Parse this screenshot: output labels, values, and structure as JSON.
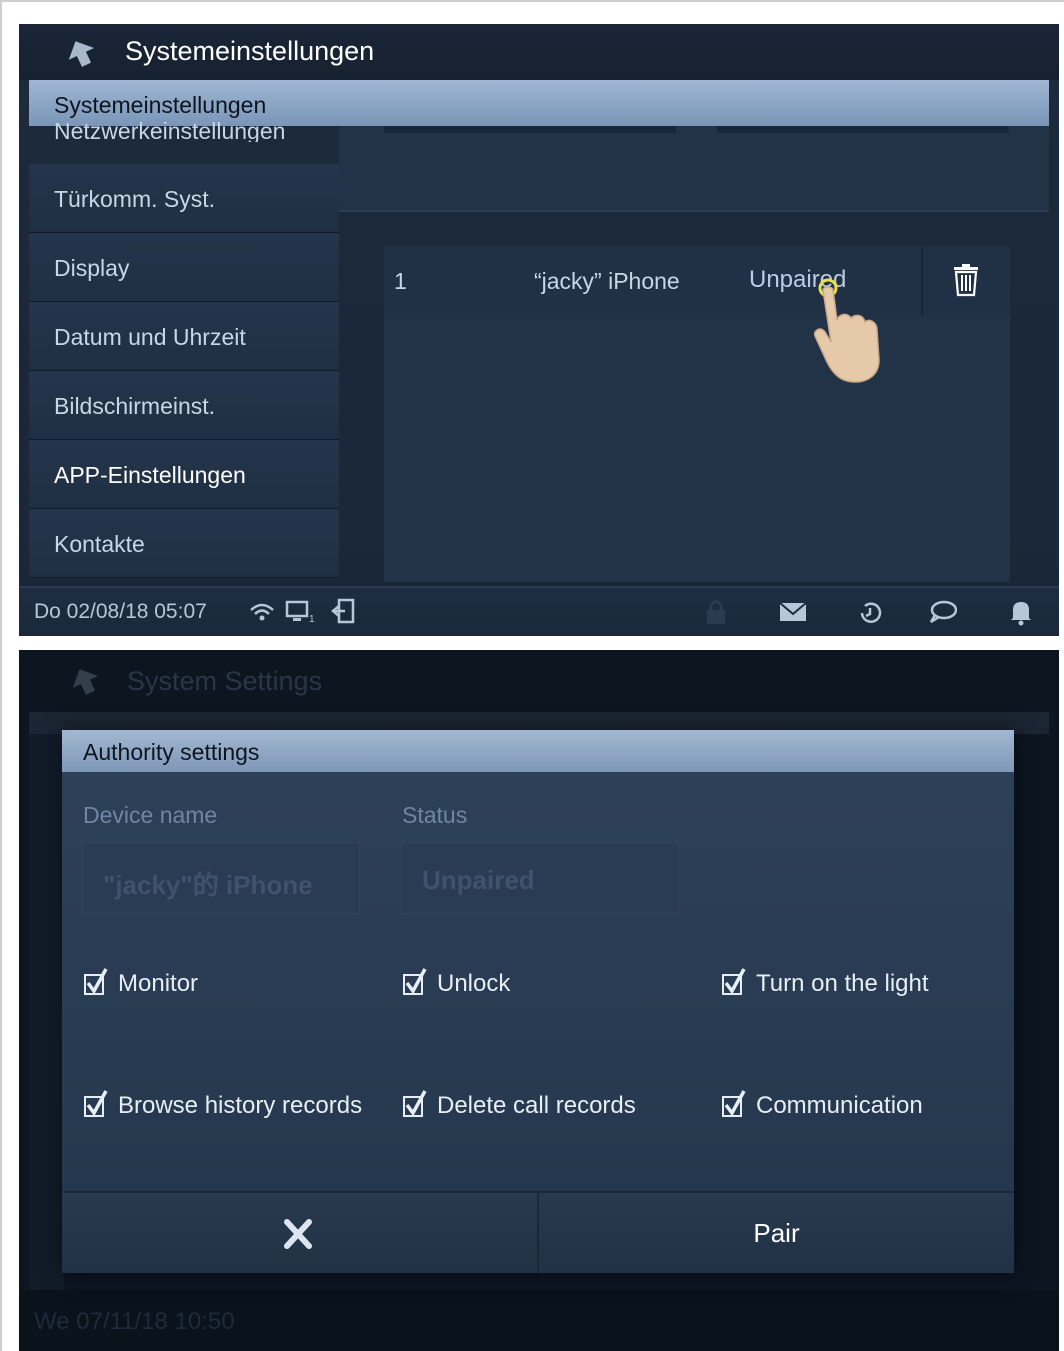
{
  "screen1": {
    "title": "Systemeinstellungen",
    "highlight_label": "Systemeinstellungen",
    "partial_item": "Netzwerkeinstellungen",
    "menu": [
      {
        "label": "Türkomm. Syst."
      },
      {
        "label": "Display"
      },
      {
        "label": "Datum und Uhrzeit"
      },
      {
        "label": "Bildschirmeinst."
      },
      {
        "label": "APP-Einstellungen"
      },
      {
        "label": "Kontakte"
      }
    ],
    "device_row": {
      "number": "1",
      "device_name": "“jacky” iPhone",
      "status": "Unpaired"
    },
    "status_bar": {
      "datetime": "Do 02/08/18  05:07"
    }
  },
  "screen2": {
    "background_title": "System Settings",
    "background_time": "We 07/11/18  10:50",
    "dialog": {
      "title": "Authority settings",
      "device_name_label": "Device name",
      "device_name_value": "\"jacky\"的 iPhone",
      "status_label": "Status",
      "status_value": "Unpaired",
      "permissions": [
        {
          "label": "Monitor",
          "checked": true
        },
        {
          "label": "Unlock",
          "checked": true
        },
        {
          "label": "Turn on the light",
          "checked": true
        },
        {
          "label": "Browse history records",
          "checked": true
        },
        {
          "label": "Delete call records",
          "checked": true
        },
        {
          "label": "Communication",
          "checked": true
        }
      ],
      "pair_label": "Pair"
    }
  },
  "colors": {
    "accent_bar": "#9fb7d4",
    "panel": "#223247",
    "text": "#c8d6e6"
  },
  "icons": [
    "back-arrow-icon",
    "trash-icon",
    "hand-pointer-icon",
    "wifi-icon",
    "monitor-icon",
    "exit-icon",
    "lock-icon",
    "mail-icon",
    "history-icon",
    "chat-icon",
    "bell-icon",
    "checkbox-icon",
    "close-icon"
  ]
}
